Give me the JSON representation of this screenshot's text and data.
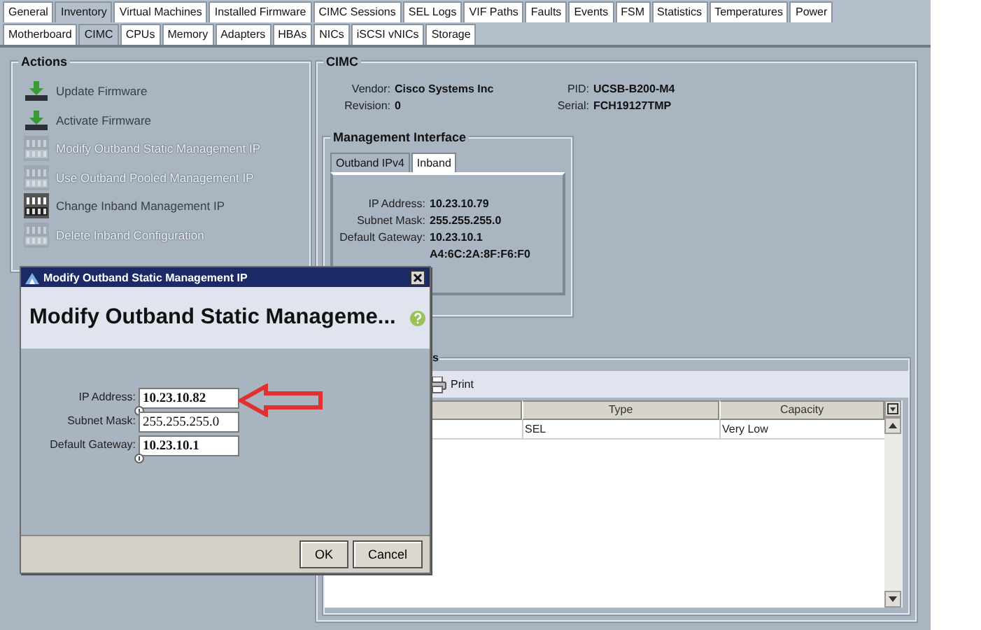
{
  "tabs": [
    {
      "label": "General",
      "selected": false
    },
    {
      "label": "Inventory",
      "selected": true
    },
    {
      "label": "Virtual Machines",
      "selected": false
    },
    {
      "label": "Installed Firmware",
      "selected": false
    },
    {
      "label": "CIMC Sessions",
      "selected": false
    },
    {
      "label": "SEL Logs",
      "selected": false
    },
    {
      "label": "VIF Paths",
      "selected": false
    },
    {
      "label": "Faults",
      "selected": false
    },
    {
      "label": "Events",
      "selected": false
    },
    {
      "label": "FSM",
      "selected": false
    },
    {
      "label": "Statistics",
      "selected": false
    },
    {
      "label": "Temperatures",
      "selected": false
    },
    {
      "label": "Power",
      "selected": false
    }
  ],
  "subtabs": [
    {
      "label": "Motherboard",
      "selected": false
    },
    {
      "label": "CIMC",
      "selected": true
    },
    {
      "label": "CPUs",
      "selected": false
    },
    {
      "label": "Memory",
      "selected": false
    },
    {
      "label": "Adapters",
      "selected": false
    },
    {
      "label": "HBAs",
      "selected": false
    },
    {
      "label": "NICs",
      "selected": false
    },
    {
      "label": "iSCSI vNICs",
      "selected": false
    },
    {
      "label": "Storage",
      "selected": false
    }
  ],
  "actions": {
    "title": "Actions",
    "items": [
      {
        "label": "Update Firmware",
        "kind": "firmware",
        "disabled": false
      },
      {
        "label": "Activate Firmware",
        "kind": "firmware",
        "disabled": false
      },
      {
        "label": "Modify Outband Static Management IP",
        "kind": "network",
        "disabled": true
      },
      {
        "label": "Use Outband Pooled Management IP",
        "kind": "network",
        "disabled": true
      },
      {
        "label": "Change Inband Management IP",
        "kind": "network",
        "disabled": false
      },
      {
        "label": "Delete Inband Configuration",
        "kind": "network",
        "disabled": true
      }
    ]
  },
  "cimc": {
    "title": "CIMC",
    "fields": [
      {
        "label": "Vendor:",
        "value": "Cisco Systems Inc"
      },
      {
        "label": "PID:",
        "value": "UCSB-B200-M4"
      },
      {
        "label": "Revision:",
        "value": "0"
      },
      {
        "label": "Serial:",
        "value": "FCH19127TMP"
      }
    ]
  },
  "management_interface": {
    "title": "Management Interface",
    "tabs": [
      {
        "label": "Outband IPv4",
        "selected": true
      },
      {
        "label": "Inband",
        "selected": false
      }
    ],
    "fields": [
      {
        "label": "IP Address:",
        "value": "10.23.10.79"
      },
      {
        "label": "Subnet Mask:",
        "value": "255.255.255.0"
      },
      {
        "label": "Default Gateway:",
        "value": "10.23.10.1"
      },
      {
        "value": "A4:6C:2A:8F:F6:F0"
      }
    ]
  },
  "table": {
    "title": "s",
    "toolbar": [
      {
        "label": "Print"
      }
    ],
    "columns": [
      "Type",
      "Capacity"
    ],
    "rows": [
      {
        "cells": [
          "SEL",
          "Very Low"
        ]
      }
    ]
  },
  "dialog": {
    "title": "Modify Outband Static Management IP",
    "heading": "Modify Outband Static Manageme...",
    "fields": [
      {
        "label": "IP Address:",
        "value": "10.23.10.82",
        "modified": true
      },
      {
        "label": "Subnet Mask:",
        "value": "255.255.255.0",
        "modified": false
      },
      {
        "label": "Default Gateway:",
        "value": "10.23.10.1",
        "modified": true
      }
    ],
    "buttons": [
      "OK",
      "Cancel"
    ]
  }
}
